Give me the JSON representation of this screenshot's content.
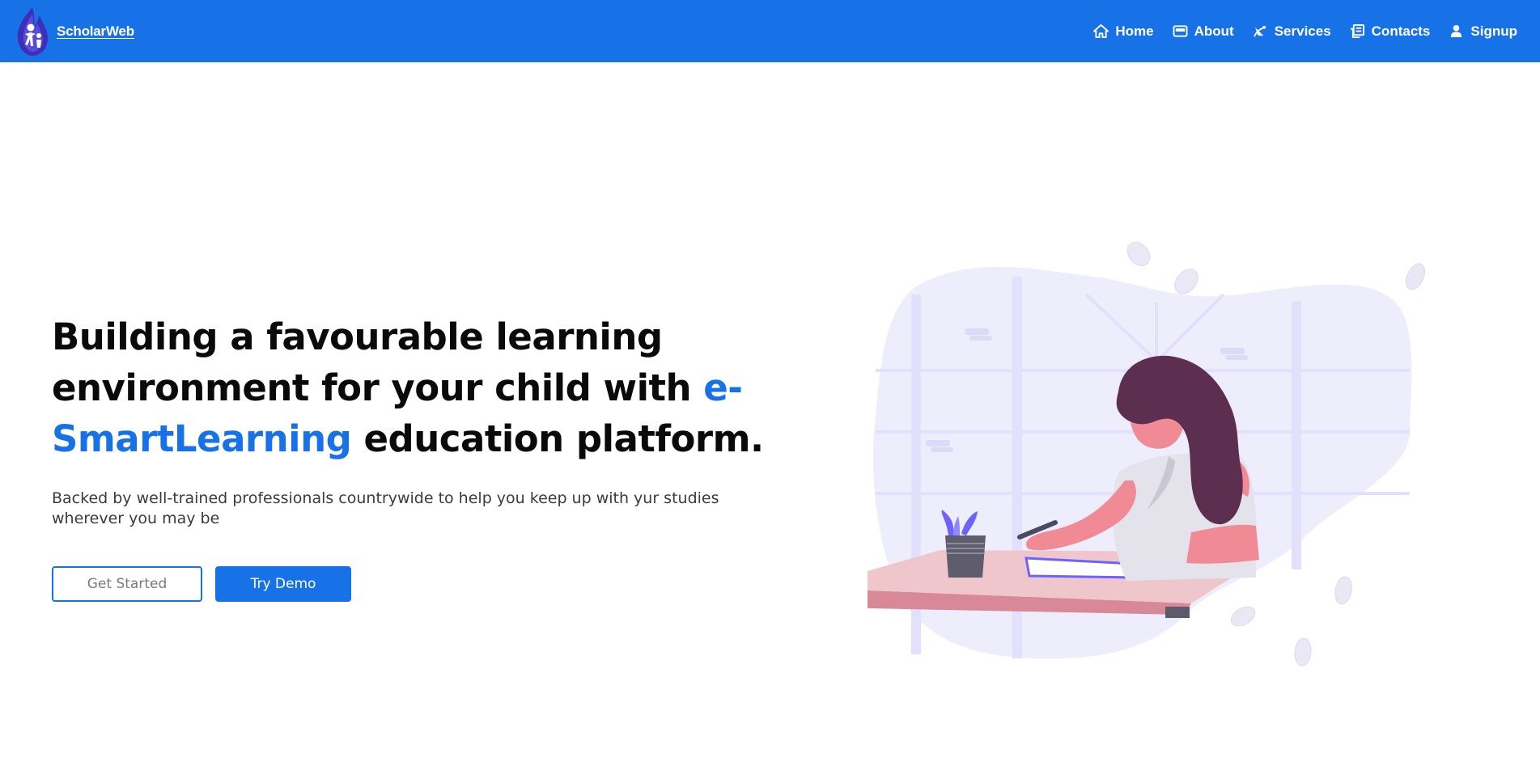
{
  "brand": {
    "name": "ScholarWeb",
    "logo_icon": "flame-person-logo"
  },
  "nav": {
    "items": [
      {
        "label": "Home",
        "icon": "home-icon"
      },
      {
        "label": "About",
        "icon": "card-icon"
      },
      {
        "label": "Services",
        "icon": "satellite-icon"
      },
      {
        "label": "Contacts",
        "icon": "contacts-icon"
      },
      {
        "label": "Signup",
        "icon": "user-icon"
      }
    ]
  },
  "hero": {
    "title_part1": "Building a favourable learning environment for your child with ",
    "title_accent": "e-SmartLearning",
    "title_part2": " education platform.",
    "subtitle": "Backed by well-trained professionals countrywide to help you keep up with yur studies wherever you may be",
    "get_started_label": "Get Started",
    "try_demo_label": "Try Demo"
  },
  "colors": {
    "primary": "#1772e8",
    "text_dark": "#0a0a0a",
    "text_muted": "#3b3b3b",
    "illustration_blob": "#eeedfc",
    "illustration_accent": "#6c63ff",
    "skin": "#f08a95",
    "hair": "#5c2e4f"
  }
}
